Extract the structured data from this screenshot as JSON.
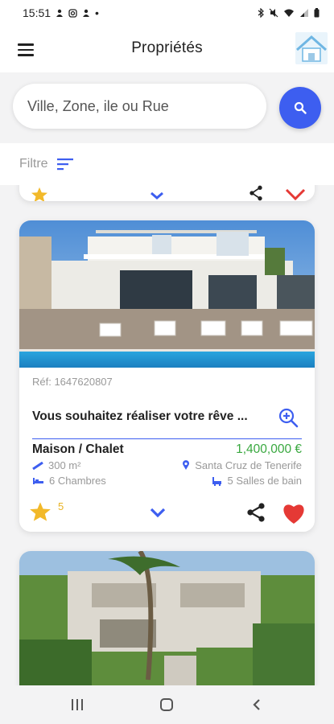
{
  "status_bar": {
    "time": "15:51",
    "dot": "•"
  },
  "app_bar": {
    "title": "Propriétés",
    "menu_icon": "hamburger-menu-icon",
    "logo_icon": "house-logo-icon"
  },
  "search": {
    "placeholder": "Ville, Zone, ile ou Rue",
    "value": "",
    "button_icon": "search-icon"
  },
  "filter": {
    "label": "Filtre",
    "icon": "sort-filter-icon"
  },
  "listing": {
    "ref": "Réf: 1647620807",
    "headline": "Vous souhaitez réaliser votre rêve ...",
    "property_type": "Maison / Chalet",
    "price": "1,400,000 €",
    "area": "300 m²",
    "location": "Santa Cruz de Tenerife",
    "bedrooms": "6 Chambres",
    "bathrooms": "5 Salles de bain",
    "rating_count": "5"
  },
  "colors": {
    "accent": "#3d5ef0",
    "price": "#39a83f",
    "star": "#f2b92a",
    "heart": "#e53935"
  },
  "nav": {
    "icons": [
      "recent-apps-icon",
      "home-icon",
      "back-icon"
    ]
  }
}
